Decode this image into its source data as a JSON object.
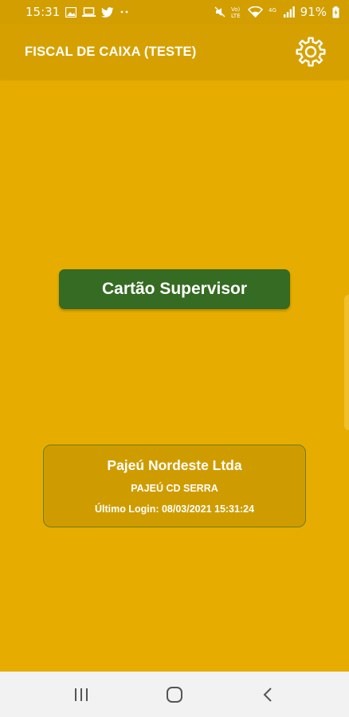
{
  "status_bar": {
    "time": "15:31",
    "battery": "91%",
    "left_icons": [
      "image-icon",
      "laptop-icon",
      "twitter-icon",
      "more-dots-icon"
    ],
    "right_icons": [
      "mute-icon",
      "volte-icon",
      "wifi-icon",
      "signal-icon",
      "battery-charging-icon"
    ]
  },
  "app_bar": {
    "title": "FISCAL DE CAIXA (TESTE)",
    "settings_icon": "gear-icon"
  },
  "main": {
    "supervisor_button": "Cartão Supervisor"
  },
  "info_card": {
    "company": "Pajeú Nordeste Ltda",
    "unit": "PAJEÚ CD SERRA",
    "last_login": "Último Login: 08/03/2021 15:31:24"
  },
  "nav_bar": {
    "buttons": [
      "recent-apps-icon",
      "home-icon",
      "back-icon"
    ]
  },
  "colors": {
    "background": "#e6ad00",
    "app_bar": "#d6a100",
    "button": "#356b22",
    "card": "#cf9c00"
  }
}
